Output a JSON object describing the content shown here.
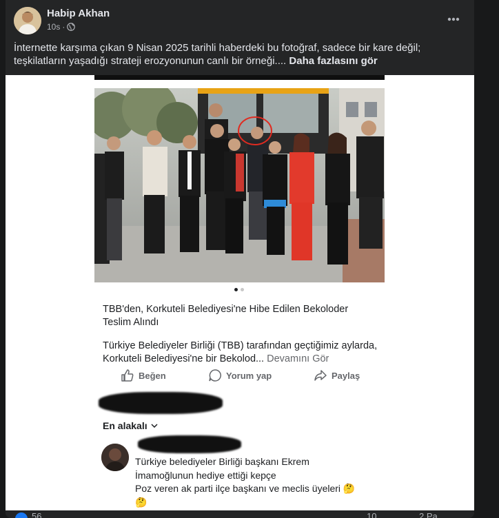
{
  "post": {
    "author": "Habip Akhan",
    "time": "10s",
    "text": "İnternette karşıma çıkan 9 Nisan 2025 tarihli haberdeki bu fotoğraf, sadece bir kare değil; teşkilatların yaşadığı strateji erozyonunun canlı bir örneği....",
    "see_more": "Daha fazlasını gör"
  },
  "shared": {
    "news_title": "TBB'den, Korkuteli Belediyesi'ne Hibe Edilen Bekoloder Teslim Alındı",
    "news_desc": "Türkiye Belediyeler Birliği (TBB) tarafından geçtiğimiz aylarda, Korkuteli Belediyesi'ne bir Bekolod...",
    "more_link": "Devamını Gör",
    "actions": {
      "like": "Beğen",
      "comment": "Yorum yap",
      "share": "Paylaş"
    },
    "sort_label": "En alakalı",
    "comment_lines": [
      "Türkiye belediyeler Birliği başkanı Ekrem",
      "İmamoğlunun hediye ettiği kepçe",
      "Poz veren ak parti ilçe başkanı ve meclis üyeleri 🤔",
      "🤔"
    ]
  },
  "footer": {
    "reactions": "56",
    "comments": "10",
    "shares": "2 Pa"
  },
  "colors": {
    "card_bg": "#242526",
    "page_bg": "#18191a",
    "text_primary": "#e4e6eb",
    "text_secondary": "#b0b3b8",
    "link_gray": "#65676b",
    "accent": "#1877f2"
  }
}
